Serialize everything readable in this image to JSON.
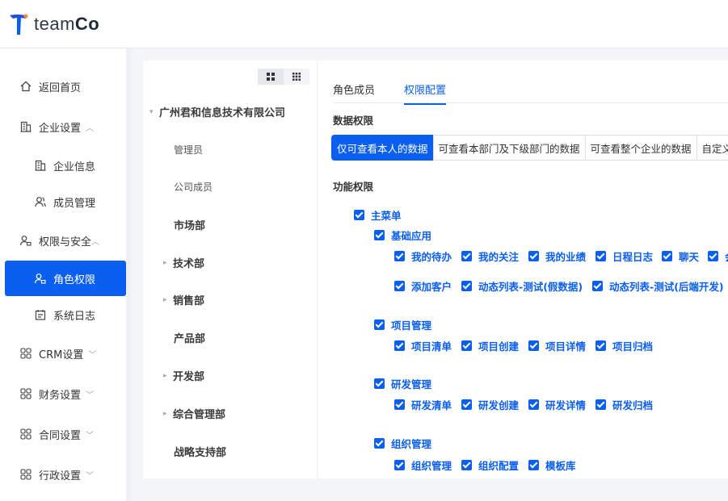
{
  "brand": {
    "name_prefix": "team",
    "name_suffix": "Co"
  },
  "colors": {
    "accent": "#0a5ef0"
  },
  "sidebar": {
    "items": [
      {
        "label": "返回首页",
        "icon": "home-icon"
      },
      {
        "label": "企业设置",
        "icon": "building-icon",
        "chevron": "︿"
      },
      {
        "label": "企业信息",
        "icon": "building-icon"
      },
      {
        "label": "成员管理",
        "icon": "users-icon"
      },
      {
        "label": "权限与安全",
        "icon": "user-lock-icon",
        "chevron": "︿"
      },
      {
        "label": "角色权限",
        "icon": "user-lock-icon"
      },
      {
        "label": "系统日志",
        "icon": "calendar-icon"
      },
      {
        "label": "CRM设置",
        "icon": "grid-icon",
        "chevron": "﹀"
      },
      {
        "label": "财务设置",
        "icon": "grid-icon",
        "chevron": "﹀"
      },
      {
        "label": "合同设置",
        "icon": "grid-icon",
        "chevron": "﹀"
      },
      {
        "label": "行政设置",
        "icon": "grid-icon",
        "chevron": "﹀"
      }
    ]
  },
  "tree": {
    "root": "广州君和信息技术有限公司",
    "nodes": [
      "管理员",
      "公司成员",
      "市场部",
      "技术部",
      "销售部",
      "产品部",
      "开发部",
      "综合管理部",
      "战略支持部"
    ]
  },
  "tabs": [
    "角色成员",
    "权限配置"
  ],
  "data_permission": {
    "title": "数据权限",
    "options": [
      "仅可查看本人的数据",
      "可查看本部门及下级部门的数据",
      "可查看整个企业的数据",
      "自定义"
    ]
  },
  "function_permission": {
    "title": "功能权限",
    "main_menu": "主菜单",
    "basic_app": "基础应用",
    "basic_row1": [
      "我的待办",
      "我的关注",
      "我的业绩",
      "日程日志",
      "聊天",
      "会"
    ],
    "basic_row2": [
      "添加客户",
      "动态列表-测试(假数据)",
      "动态列表-测试(后端开发)"
    ],
    "project": "项目管理",
    "project_items": [
      "项目清单",
      "项目创建",
      "项目详情",
      "项目归档"
    ],
    "rd": "研发管理",
    "rd_items": [
      "研发清单",
      "研发创建",
      "研发详情",
      "研发归档"
    ],
    "org": "组织管理",
    "org_items": [
      "组织管理",
      "组织配置",
      "模板库"
    ]
  }
}
